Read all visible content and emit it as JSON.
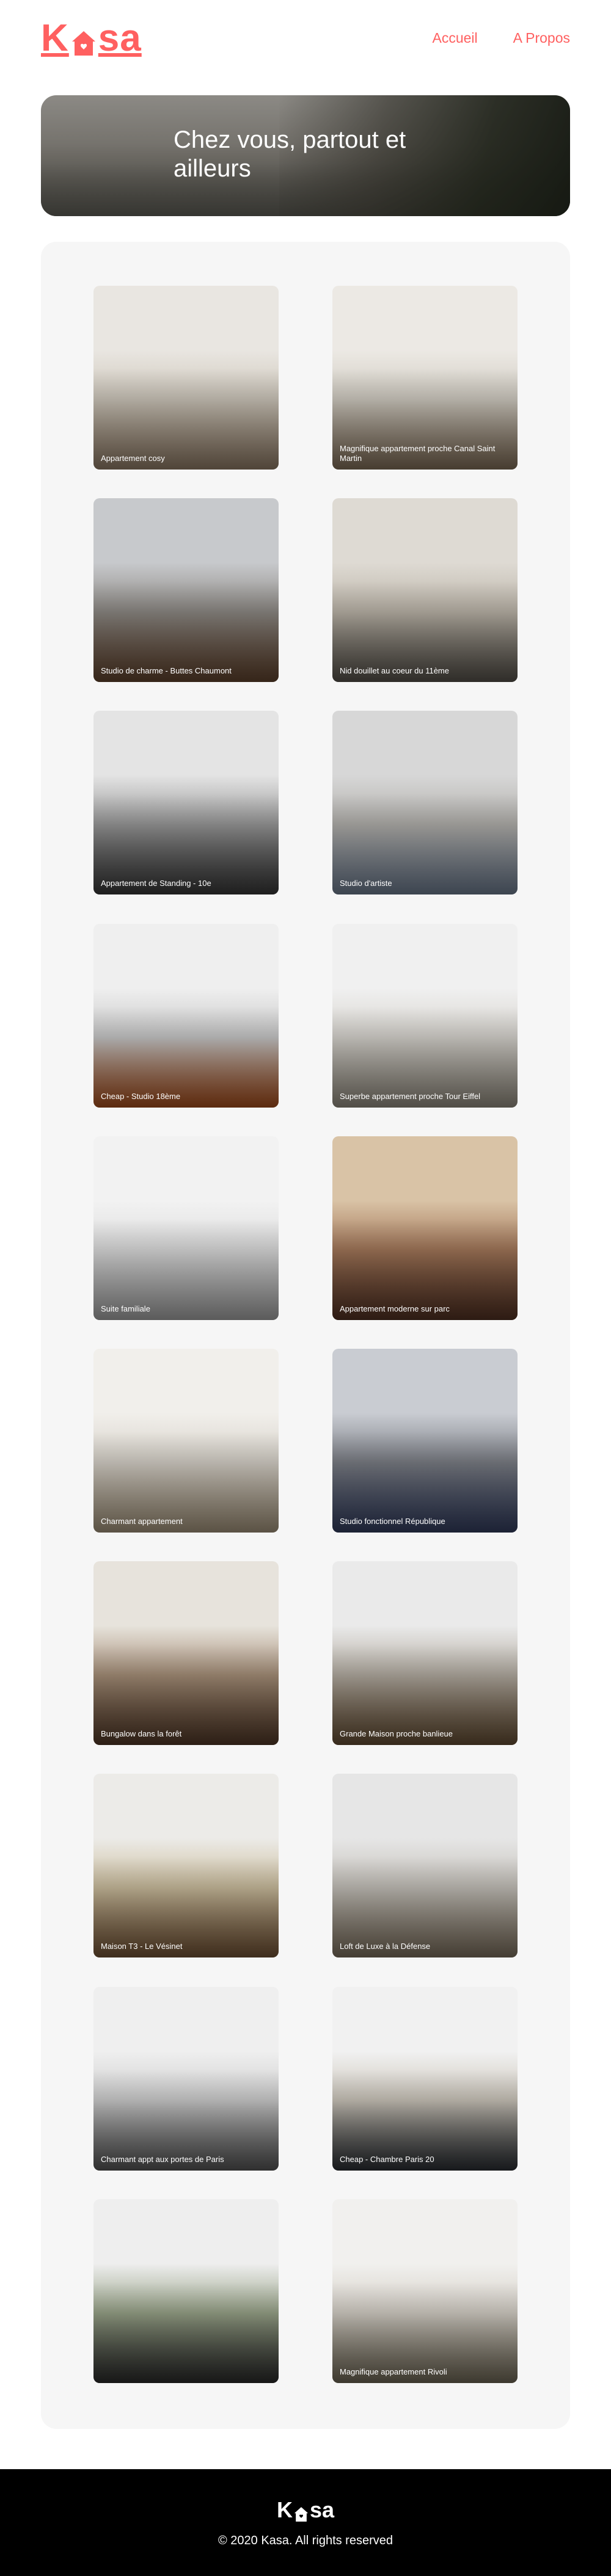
{
  "brand": {
    "name_start": "K",
    "name_end": "sa",
    "color": "#FF6060"
  },
  "nav": [
    {
      "label": "Accueil"
    },
    {
      "label": "A Propos"
    }
  ],
  "hero": {
    "title": "Chez vous, partout et ailleurs"
  },
  "listings": [
    {
      "title": "Appartement cosy",
      "tones": [
        "#e9e6e1",
        "#cfc8bc",
        "#a08a72"
      ]
    },
    {
      "title": "Magnifique appartement proche Canal Saint Martin",
      "tones": [
        "#ece9e4",
        "#d2cdc3",
        "#8f7a62"
      ]
    },
    {
      "title": "Studio de charme - Buttes Chaumont",
      "tones": [
        "#c7c9cc",
        "#8e8a85",
        "#6b4a32"
      ]
    },
    {
      "title": "Nid douillet au coeur du 11ème",
      "tones": [
        "#dedad3",
        "#bdb6aa",
        "#5f5a52"
      ]
    },
    {
      "title": "Appartement de Standing - 10e",
      "tones": [
        "#e4e4e4",
        "#9a9a9a",
        "#3e3e3e"
      ]
    },
    {
      "title": "Studio d'artiste",
      "tones": [
        "#d7d7d7",
        "#b3b1ad",
        "#7a8aa0"
      ]
    },
    {
      "title": "Cheap - Studio 18ème",
      "tones": [
        "#efefef",
        "#c9c9c9",
        "#b9561f"
      ]
    },
    {
      "title": "Superbe appartement proche Tour Eiffel",
      "tones": [
        "#f0f0f0",
        "#d9d6d0",
        "#a39c8e"
      ]
    },
    {
      "title": "Suite familiale",
      "tones": [
        "#f2f2f2",
        "#dedede",
        "#b7b7b7"
      ]
    },
    {
      "title": "Appartement moderne sur parc",
      "tones": [
        "#d9c3a6",
        "#a4785a",
        "#5a3626"
      ]
    },
    {
      "title": "Charmant appartement",
      "tones": [
        "#f1efeb",
        "#d8d3ca",
        "#b6a58a"
      ]
    },
    {
      "title": "Studio fonctionnel République",
      "tones": [
        "#c9ccd2",
        "#7c7f86",
        "#39456a"
      ]
    },
    {
      "title": "Bungalow dans la forêt",
      "tones": [
        "#e7e3dc",
        "#a8917a",
        "#5a3e2b"
      ]
    },
    {
      "title": "Grande Maison proche banlieue",
      "tones": [
        "#eaeaea",
        "#b5aea3",
        "#6f5538"
      ]
    },
    {
      "title": "Maison T3 - Le Vésinet",
      "tones": [
        "#ecebe8",
        "#cdbf9f",
        "#7e5b3a"
      ]
    },
    {
      "title": "Loft de Luxe à la Défense",
      "tones": [
        "#e6e6e6",
        "#c6c2bb",
        "#8a7c68"
      ]
    },
    {
      "title": "Charmant appt aux portes de Paris",
      "tones": [
        "#efefef",
        "#cfcfcf",
        "#5f5f5f"
      ]
    },
    {
      "title": "Cheap - Chambre Paris 20",
      "tones": [
        "#f1f1f1",
        "#cdc7bc",
        "#2f3338"
      ]
    },
    {
      "title": "",
      "tones": [
        "#eeeeee",
        "#9aa58a",
        "#2f2f2f"
      ]
    },
    {
      "title": "Magnifique appartement Rivoli",
      "tones": [
        "#f1f0ee",
        "#d6d1c8",
        "#7b735f"
      ]
    }
  ],
  "footer": {
    "copyright": "© 2020 Kasa. All rights reserved"
  }
}
